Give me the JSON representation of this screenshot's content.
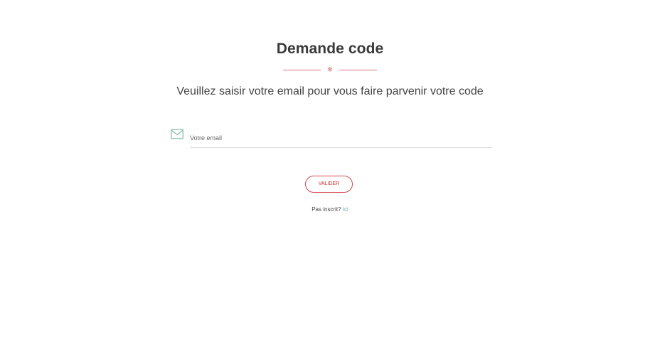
{
  "header": {
    "title": "Demande code",
    "divider_glyph": "❄",
    "subtitle": "Veuillez saisir votre email pour vous faire parvenir votre code"
  },
  "form": {
    "email_icon": "envelope-icon",
    "email_placeholder": "Votre email",
    "email_value": "",
    "submit_label": "VALIDER"
  },
  "footer": {
    "signup_text": "Pas inscrit?",
    "signup_link_label": "Ici"
  },
  "colors": {
    "accent_red": "#d9484e",
    "divider_pink": "#d6787c",
    "icon_green": "#8bc0a3",
    "link_teal": "#6aa9a9",
    "title_text": "#3a3a3a"
  }
}
